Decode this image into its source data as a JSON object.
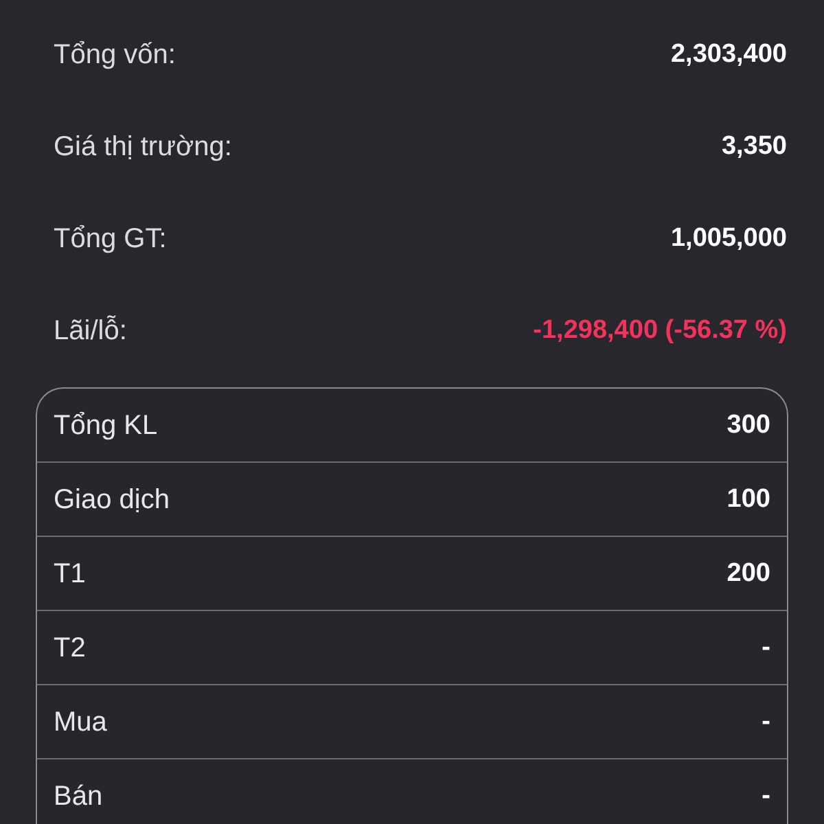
{
  "summary": [
    {
      "label": "Tổng vốn:",
      "value": "2,303,400",
      "color": "#ffffff"
    },
    {
      "label": "Giá thị trường:",
      "value": "3,350",
      "color": "#ffffff"
    },
    {
      "label": "Tổng GT:",
      "value": "1,005,000",
      "color": "#ffffff"
    },
    {
      "label": "Lãi/lỗ:",
      "value": "-1,298,400 (-56.37 %)",
      "color": "#f5325b"
    }
  ],
  "volume_table": {
    "rows": [
      {
        "label": "Tổng KL",
        "value": "300"
      },
      {
        "label": "Giao dịch",
        "value": "100"
      },
      {
        "label": "T1",
        "value": "200"
      },
      {
        "label": "T2",
        "value": "-"
      },
      {
        "label": "Mua",
        "value": "-"
      },
      {
        "label": "Bán",
        "value": "-"
      }
    ]
  }
}
